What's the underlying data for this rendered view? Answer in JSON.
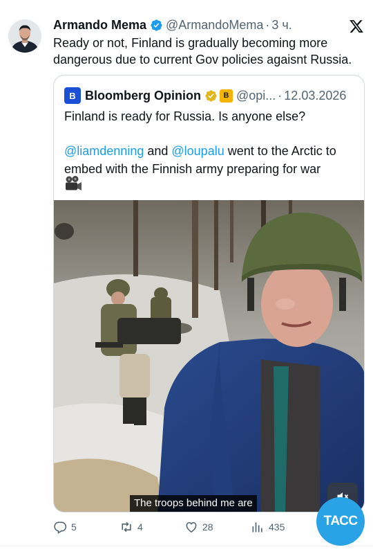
{
  "author": {
    "name": "Armando Mema",
    "handle": "@ArmandoMema",
    "separator": "·",
    "time": "3 ч."
  },
  "tweet": {
    "text": "Ready or not, Finland is gradually becoming more dangerous due to current Gov policies agaisnt Russia."
  },
  "quote": {
    "logo_letter": "B",
    "name": "Bloomberg Opinion",
    "affiliate_letter": "B",
    "handle": "@opi...",
    "separator": "·",
    "date": "12.03.2026",
    "line1": "Finland is ready for Russia. Is anyone else?",
    "mention1": "@liamdenning",
    "and_text": " and ",
    "mention2": "@loupalu",
    "rest_text": " went to the Arctic to embed with the Finnish army preparing for war",
    "camera_icon": "video-camera-emoji"
  },
  "media": {
    "caption": "The troops behind me are"
  },
  "actions": {
    "replies": "5",
    "reposts": "4",
    "likes": "28",
    "views": "435"
  },
  "watermark": {
    "text": "ТАСС",
    "color": "#29a3e6"
  },
  "colors": {
    "accent": "#1d9bf0",
    "muted": "#536471",
    "verified": "#1d9bf0",
    "gold_badge": "#e2b719"
  }
}
